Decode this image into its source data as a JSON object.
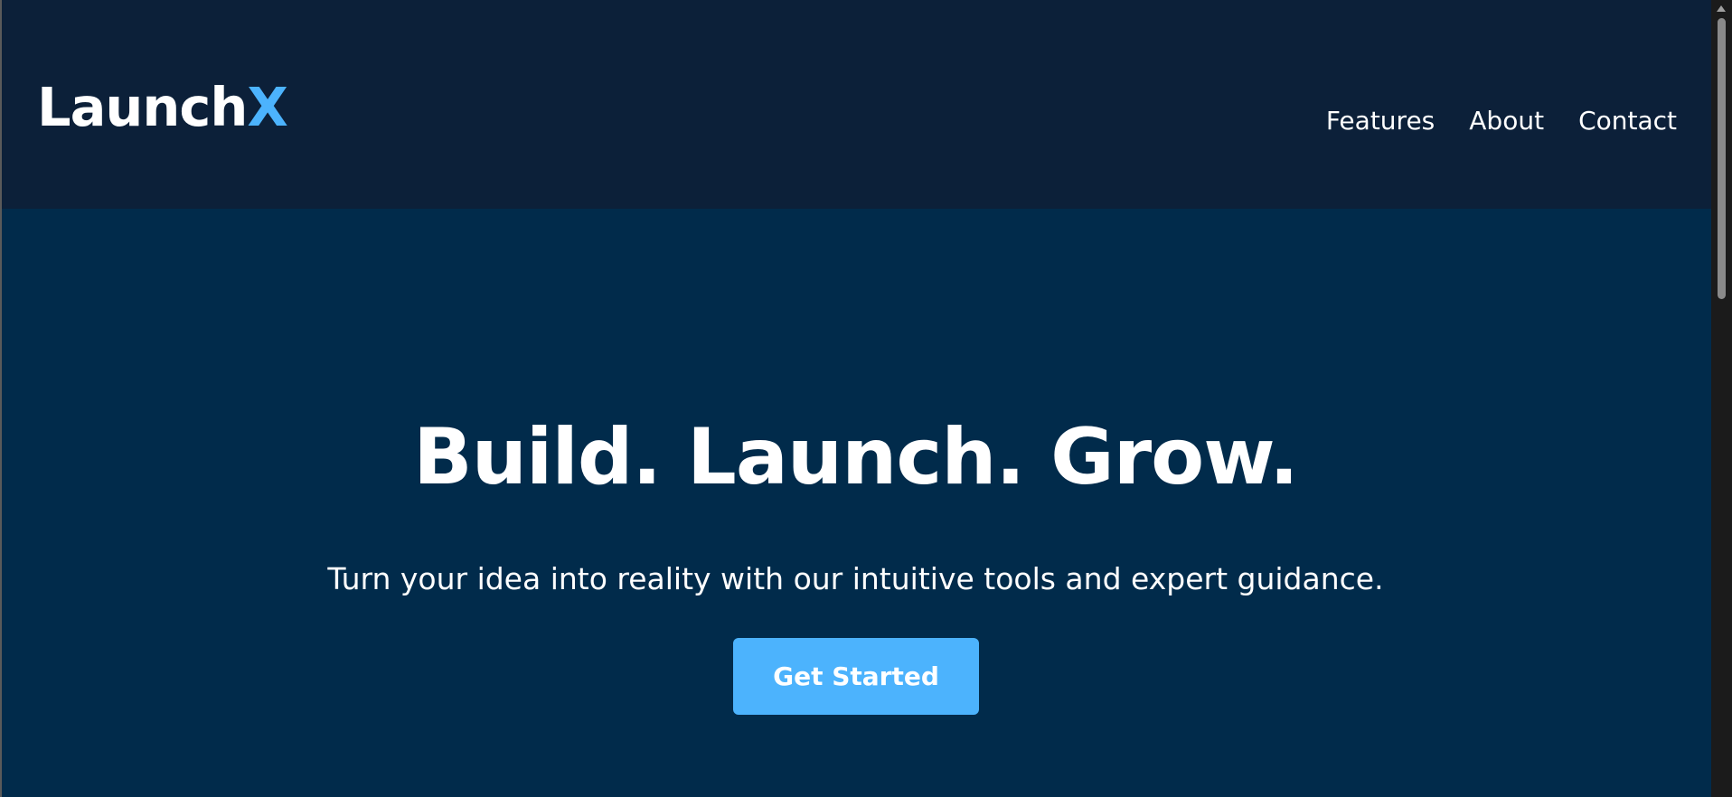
{
  "header": {
    "logo_main": "Launch",
    "logo_accent": "X",
    "nav": [
      "Features",
      "About",
      "Contact"
    ]
  },
  "hero": {
    "title": "Build. Launch. Grow.",
    "subtitle": "Turn your idea into reality with our intuitive tools and expert guidance.",
    "cta_label": "Get Started"
  },
  "colors": {
    "header_bg": "#0c2039",
    "hero_bg": "#012b4b",
    "accent": "#4cb3fd",
    "text": "#ffffff"
  }
}
